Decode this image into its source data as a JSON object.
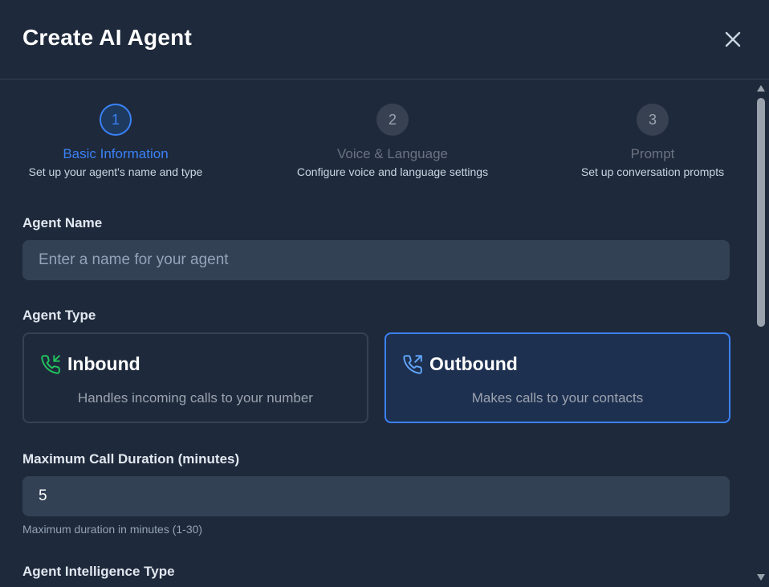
{
  "modal": {
    "title": "Create AI Agent",
    "close_icon": "close-icon"
  },
  "steps": [
    {
      "number": "1",
      "title": "Basic Information",
      "subtitle": "Set up your agent's name and type",
      "active": true
    },
    {
      "number": "2",
      "title": "Voice & Language",
      "subtitle": "Configure voice and language settings",
      "active": false
    },
    {
      "number": "3",
      "title": "Prompt",
      "subtitle": "Set up conversation prompts",
      "active": false
    }
  ],
  "form": {
    "agent_name": {
      "label": "Agent Name",
      "placeholder": "Enter a name for your agent",
      "value": ""
    },
    "agent_type": {
      "label": "Agent Type",
      "options": [
        {
          "title": "Inbound",
          "description": "Handles incoming calls to your number",
          "icon": "phone-incoming-icon",
          "selected": false
        },
        {
          "title": "Outbound",
          "description": "Makes calls to your contacts",
          "icon": "phone-outgoing-icon",
          "selected": true
        }
      ]
    },
    "max_duration": {
      "label": "Maximum Call Duration (minutes)",
      "value": "5",
      "hint": "Maximum duration in minutes (1-30)"
    },
    "intelligence_type": {
      "label": "Agent Intelligence Type"
    }
  },
  "colors": {
    "background": "#1e293b",
    "accent": "#3b82f6",
    "input_bg": "#334155",
    "inbound_icon": "#22c55e",
    "outbound_icon": "#60a5fa"
  }
}
